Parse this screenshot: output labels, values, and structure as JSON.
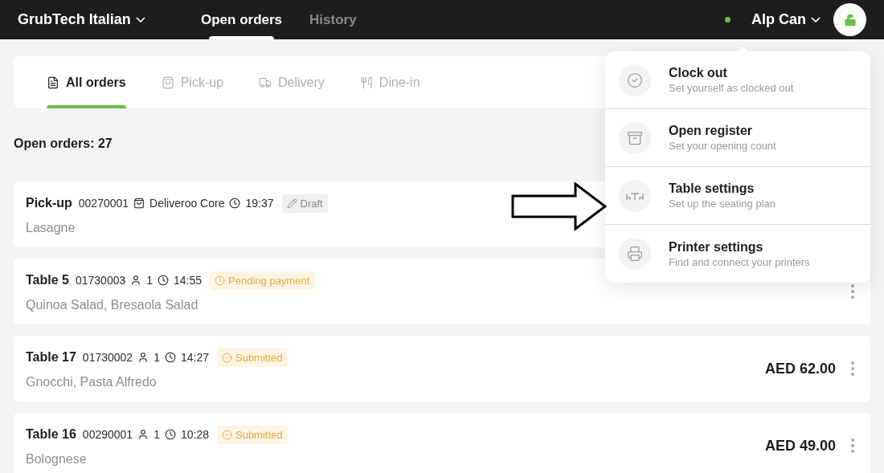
{
  "header": {
    "restaurant": "GrubTech Italian",
    "nav": [
      {
        "label": "Open orders",
        "selected": true
      },
      {
        "label": "History",
        "selected": false
      }
    ],
    "user": {
      "name": "Alp Can",
      "online": true
    }
  },
  "filters": [
    {
      "label": "All orders",
      "kind": "all",
      "selected": true
    },
    {
      "label": "Pick-up",
      "kind": "pickup",
      "selected": false
    },
    {
      "label": "Delivery",
      "kind": "delivery",
      "selected": false
    },
    {
      "label": "Dine-in",
      "kind": "dinein",
      "selected": false
    }
  ],
  "summary": "Open orders: 27",
  "orders": [
    {
      "title": "Pick-up",
      "number": "00270001",
      "meta": [
        {
          "kind": "source",
          "text": "Deliveroo Core"
        },
        {
          "kind": "time",
          "text": "19:37"
        }
      ],
      "status": {
        "kind": "draft",
        "label": "Draft"
      },
      "items": "Lasagne"
    },
    {
      "title": "Table 5",
      "number": "01730003",
      "meta": [
        {
          "kind": "guests",
          "text": "1"
        },
        {
          "kind": "time",
          "text": "14:55"
        }
      ],
      "status": {
        "kind": "pending",
        "label": "Pending payment"
      },
      "items": "Quinoa Salad, Bresaola Salad"
    },
    {
      "title": "Table 17",
      "number": "01730002",
      "meta": [
        {
          "kind": "guests",
          "text": "1"
        },
        {
          "kind": "time",
          "text": "14:27"
        }
      ],
      "status": {
        "kind": "submitted",
        "label": "Submitted"
      },
      "items": "Gnocchi, Pasta Alfredo",
      "price": "AED 62.00"
    },
    {
      "title": "Table 16",
      "number": "00290001",
      "meta": [
        {
          "kind": "guests",
          "text": "1"
        },
        {
          "kind": "time",
          "text": "10:28"
        }
      ],
      "status": {
        "kind": "submitted",
        "label": "Submitted"
      },
      "items": "Bolognese",
      "price": "AED 49.00"
    }
  ],
  "menu": [
    {
      "kind": "clock",
      "title": "Clock out",
      "subtitle": "Set yourself as clocked out"
    },
    {
      "kind": "register",
      "title": "Open register",
      "subtitle": "Set your opening count"
    },
    {
      "kind": "table",
      "title": "Table settings",
      "subtitle": "Set up the seating plan"
    },
    {
      "kind": "printer",
      "title": "Printer settings",
      "subtitle": "Find and connect your printers"
    }
  ]
}
